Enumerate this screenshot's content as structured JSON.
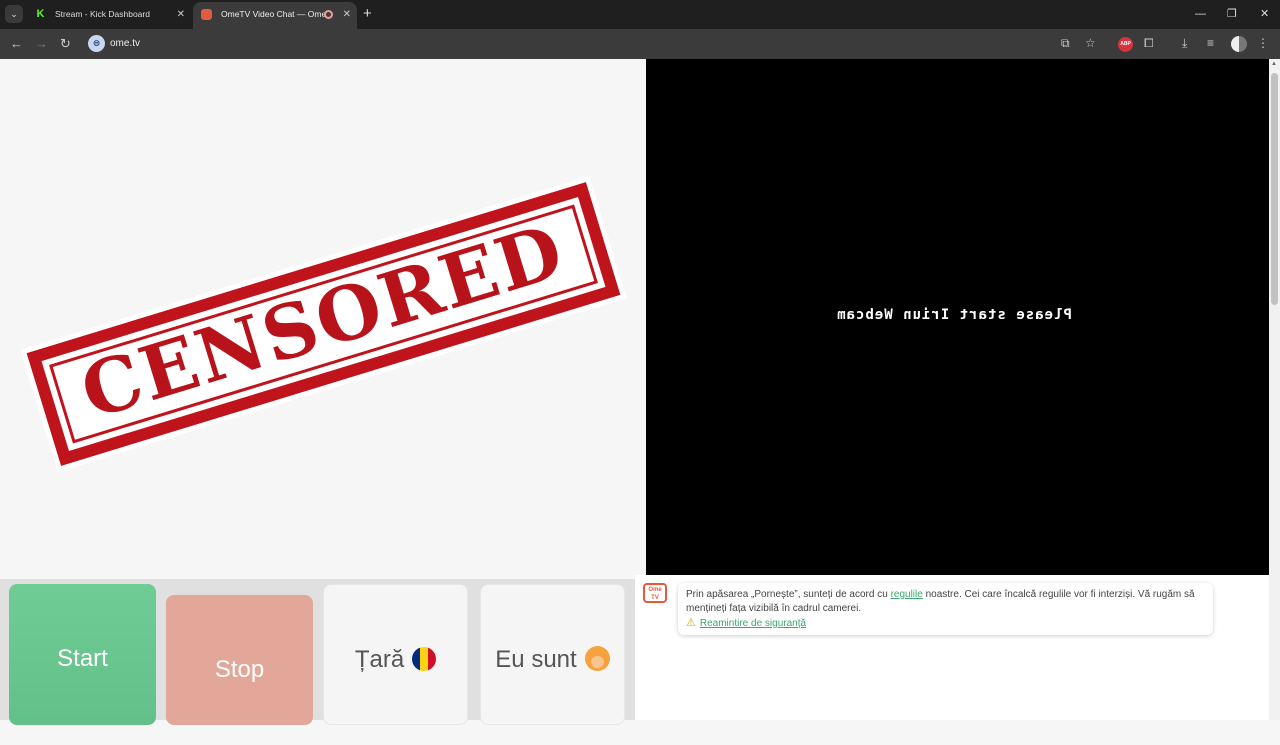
{
  "browser": {
    "tabs": [
      {
        "title": "Stream - Kick Dashboard",
        "favicon": "K"
      },
      {
        "title": "OmeTV Video Chat — Ome",
        "favicon": "tv"
      }
    ],
    "new_tab": "+",
    "url": "ome.tv",
    "abp_label": "ABP"
  },
  "main": {
    "stamp_text": "CENSORED",
    "webcam_message": "Please start Iriun Webcam"
  },
  "controls": {
    "start_label": "Start",
    "stop_label": "Stop",
    "country_label": "Țară",
    "gender_label": "Eu sunt"
  },
  "chat": {
    "logo": "Ome TV",
    "notice_pre": "Prin apăsarea „Pornește”, sunteți de acord cu ",
    "rules_link": "regulile",
    "notice_post": " noastre. Cei care încalcă regulile vor fi interziși. Vă rugăm să mențineți fața vizibilă în cadrul camerei.",
    "safety_link": "Reamintire de siguranță"
  },
  "colors": {
    "start": "#6fcc94",
    "stop": "#e2a799",
    "stamp_red": "#c0141c",
    "link_green": "#3aa76d"
  }
}
